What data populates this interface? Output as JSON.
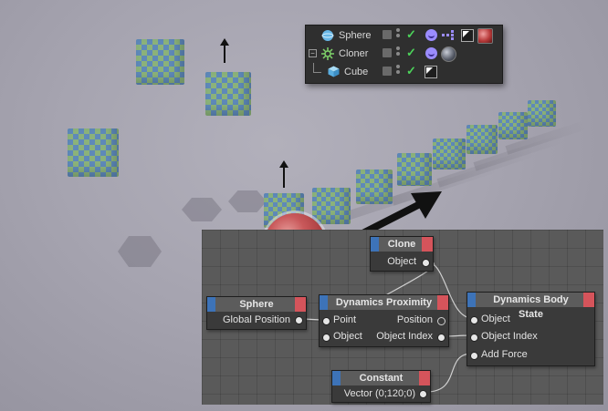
{
  "object_manager": {
    "rows": [
      {
        "label": "Sphere",
        "icon": "sphere-icon",
        "has_ball_tag": true,
        "ball_color": "#b83a3a"
      },
      {
        "label": "Cloner",
        "icon": "cloner-icon",
        "has_ball_tag": true,
        "ball_color": "#555a66"
      },
      {
        "label": "Cube",
        "icon": "cube-icon",
        "has_ball_tag": false
      }
    ]
  },
  "nodes": {
    "clone": {
      "title": "Clone",
      "ports": [
        "Object"
      ]
    },
    "sphere": {
      "title": "Sphere",
      "ports": [
        "Global Position"
      ]
    },
    "dynamics_proximity": {
      "title": "Dynamics Proximity",
      "inputs": [
        "Point",
        "Object"
      ],
      "outputs": [
        "Position",
        "Object Index"
      ]
    },
    "dynamics_body_state": {
      "title": "Dynamics Body State",
      "inputs": [
        "Object",
        "Object Index",
        "Add Force"
      ]
    },
    "constant": {
      "title": "Constant",
      "ports": [
        "Vector (0;120;0)"
      ]
    }
  },
  "colors": {
    "node_header_blue": "#3d73b8",
    "node_header_red": "#d5545b",
    "check_green": "#4cd35a",
    "sphere_red": "#c9595b"
  }
}
